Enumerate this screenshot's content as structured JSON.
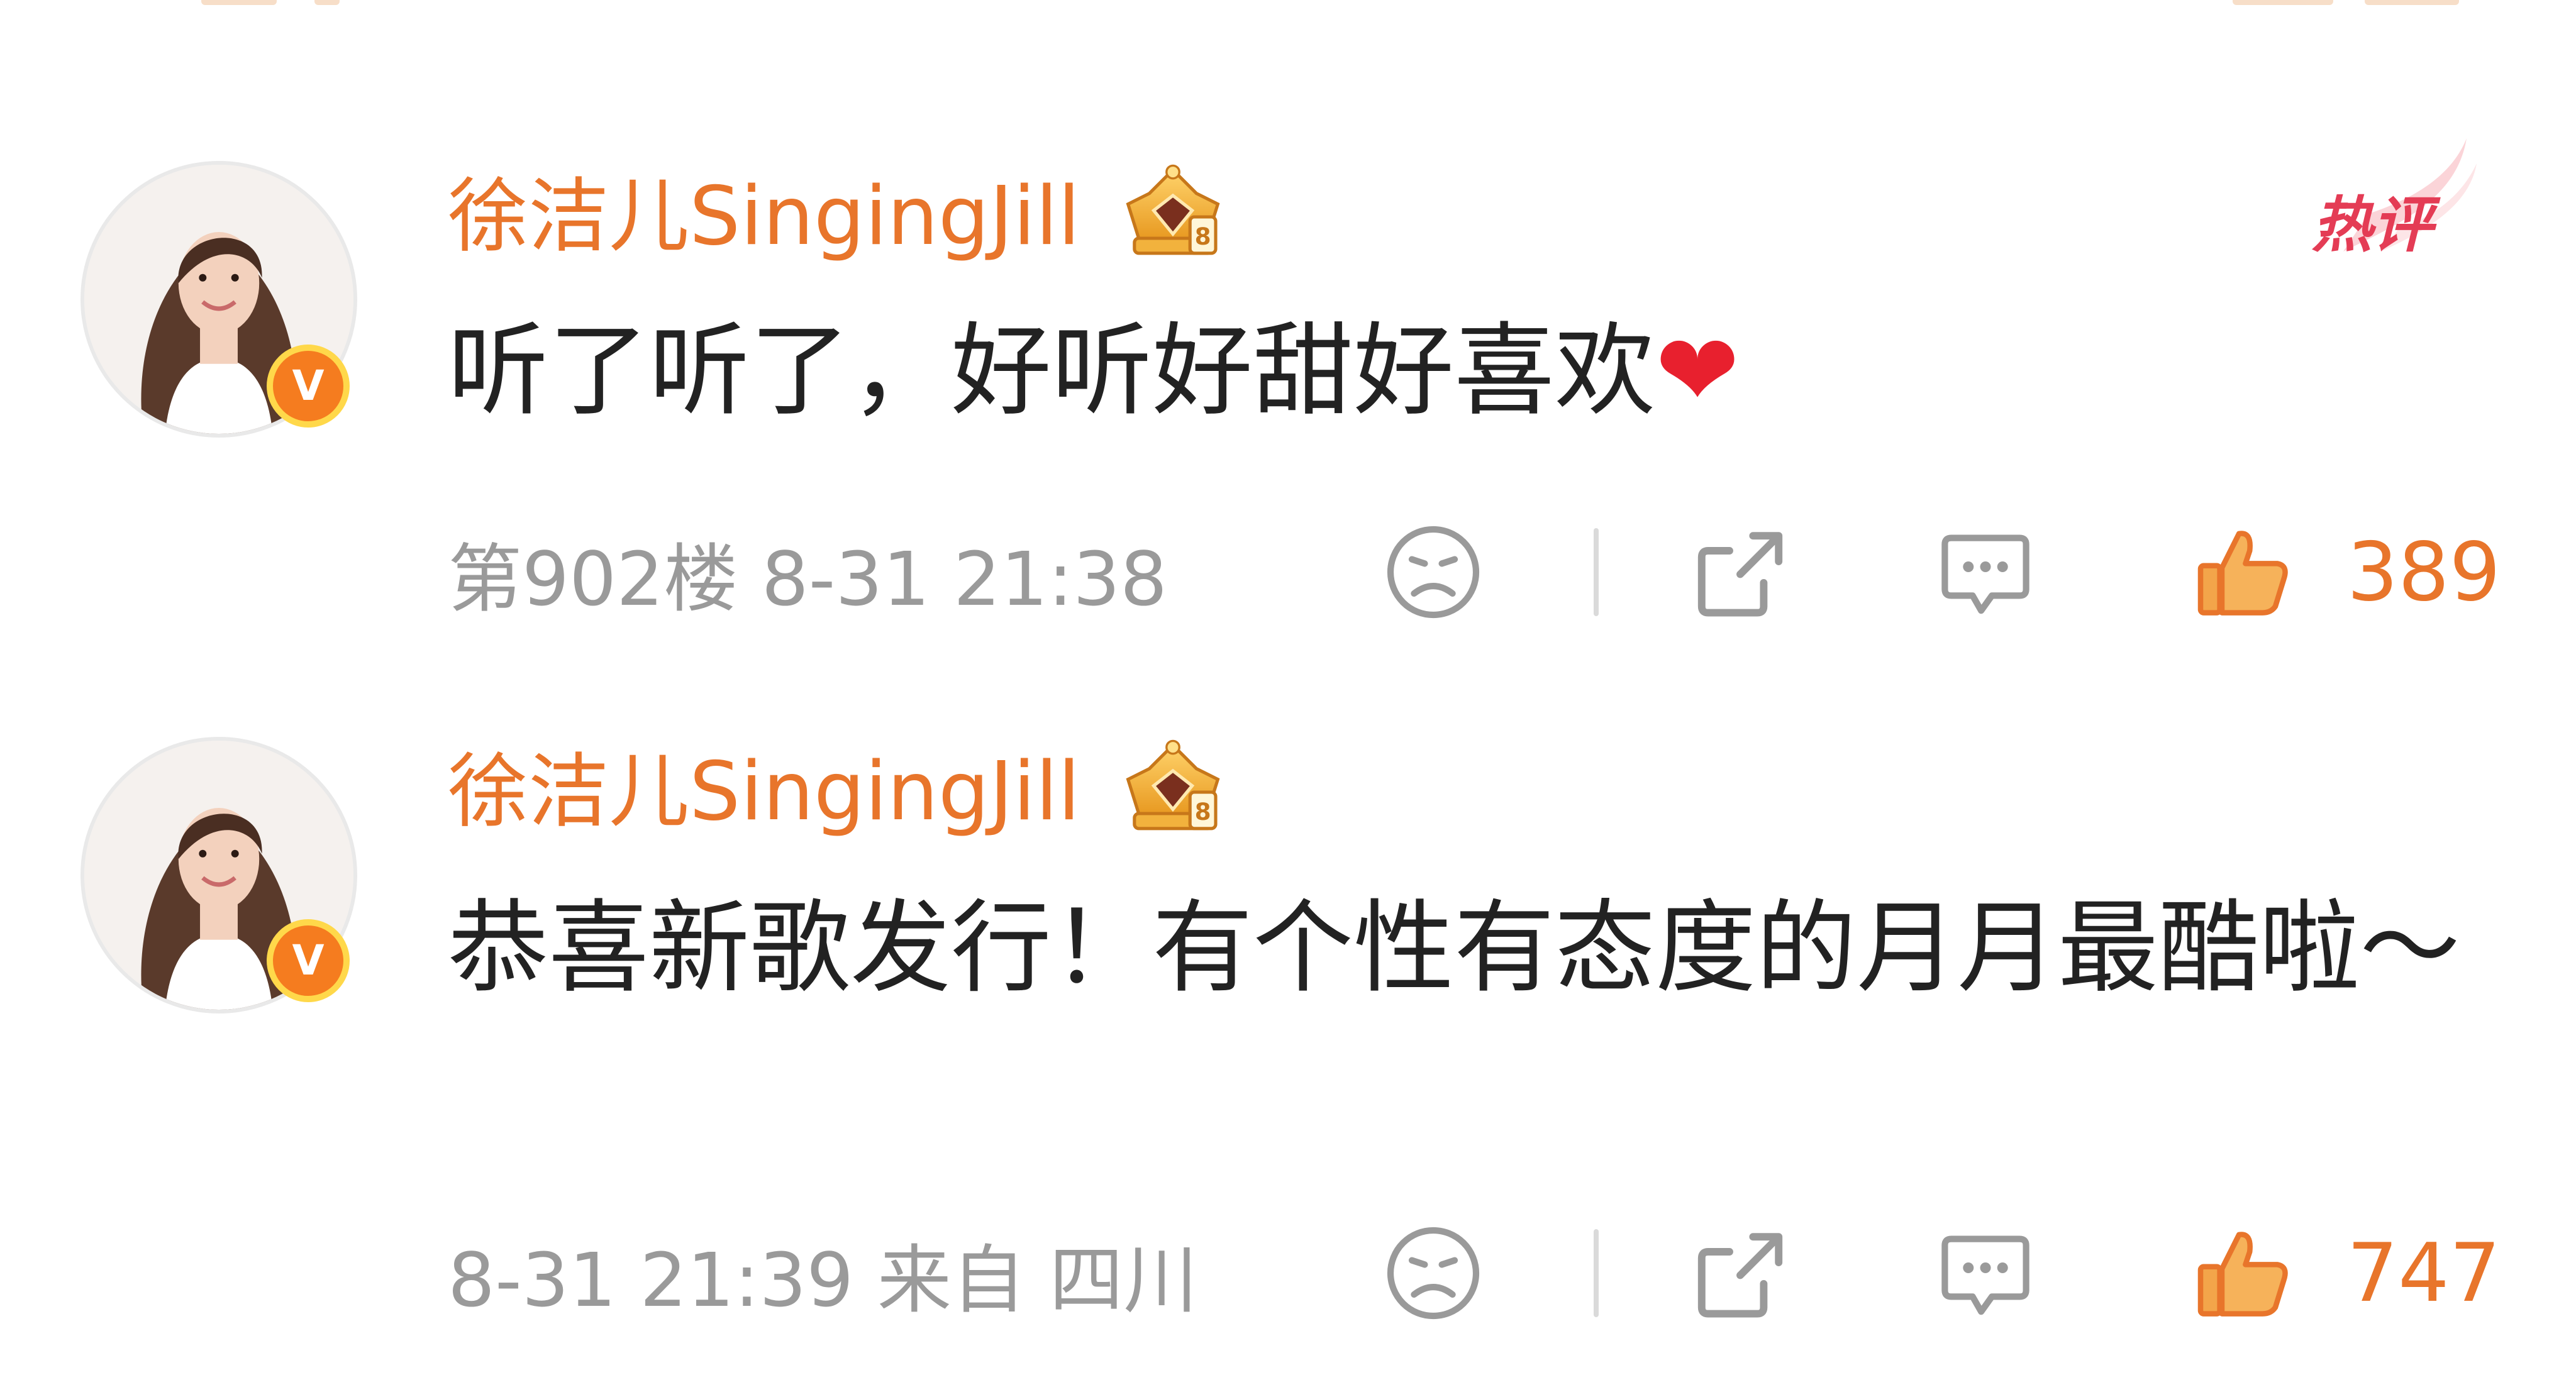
{
  "comments": [
    {
      "author": "徐洁儿SingingJill",
      "verified_mark": "V",
      "hot_label": "热评",
      "text": "听了听了，好听好甜好喜欢",
      "emoji": "❤",
      "meta": "第902楼 8-31 21:38",
      "like_count": "389"
    },
    {
      "author": "徐洁儿SingingJill",
      "verified_mark": "V",
      "text": "恭喜新歌发行！有个性有态度的月月最酷啦～",
      "meta": "8-31 21:39 来自 四川",
      "like_count": "747"
    }
  ],
  "icons": {
    "dislike": "sad-face-icon",
    "share": "share-icon",
    "reply": "comment-bubble-icon",
    "like": "thumbs-up-icon",
    "badge": "crown-badge-icon"
  },
  "colors": {
    "author": "#e8752b",
    "like": "#e8752b",
    "meta": "#9a9a9a",
    "body": "#222222",
    "hot": "#e43c55",
    "verified": "#f57c1f"
  }
}
